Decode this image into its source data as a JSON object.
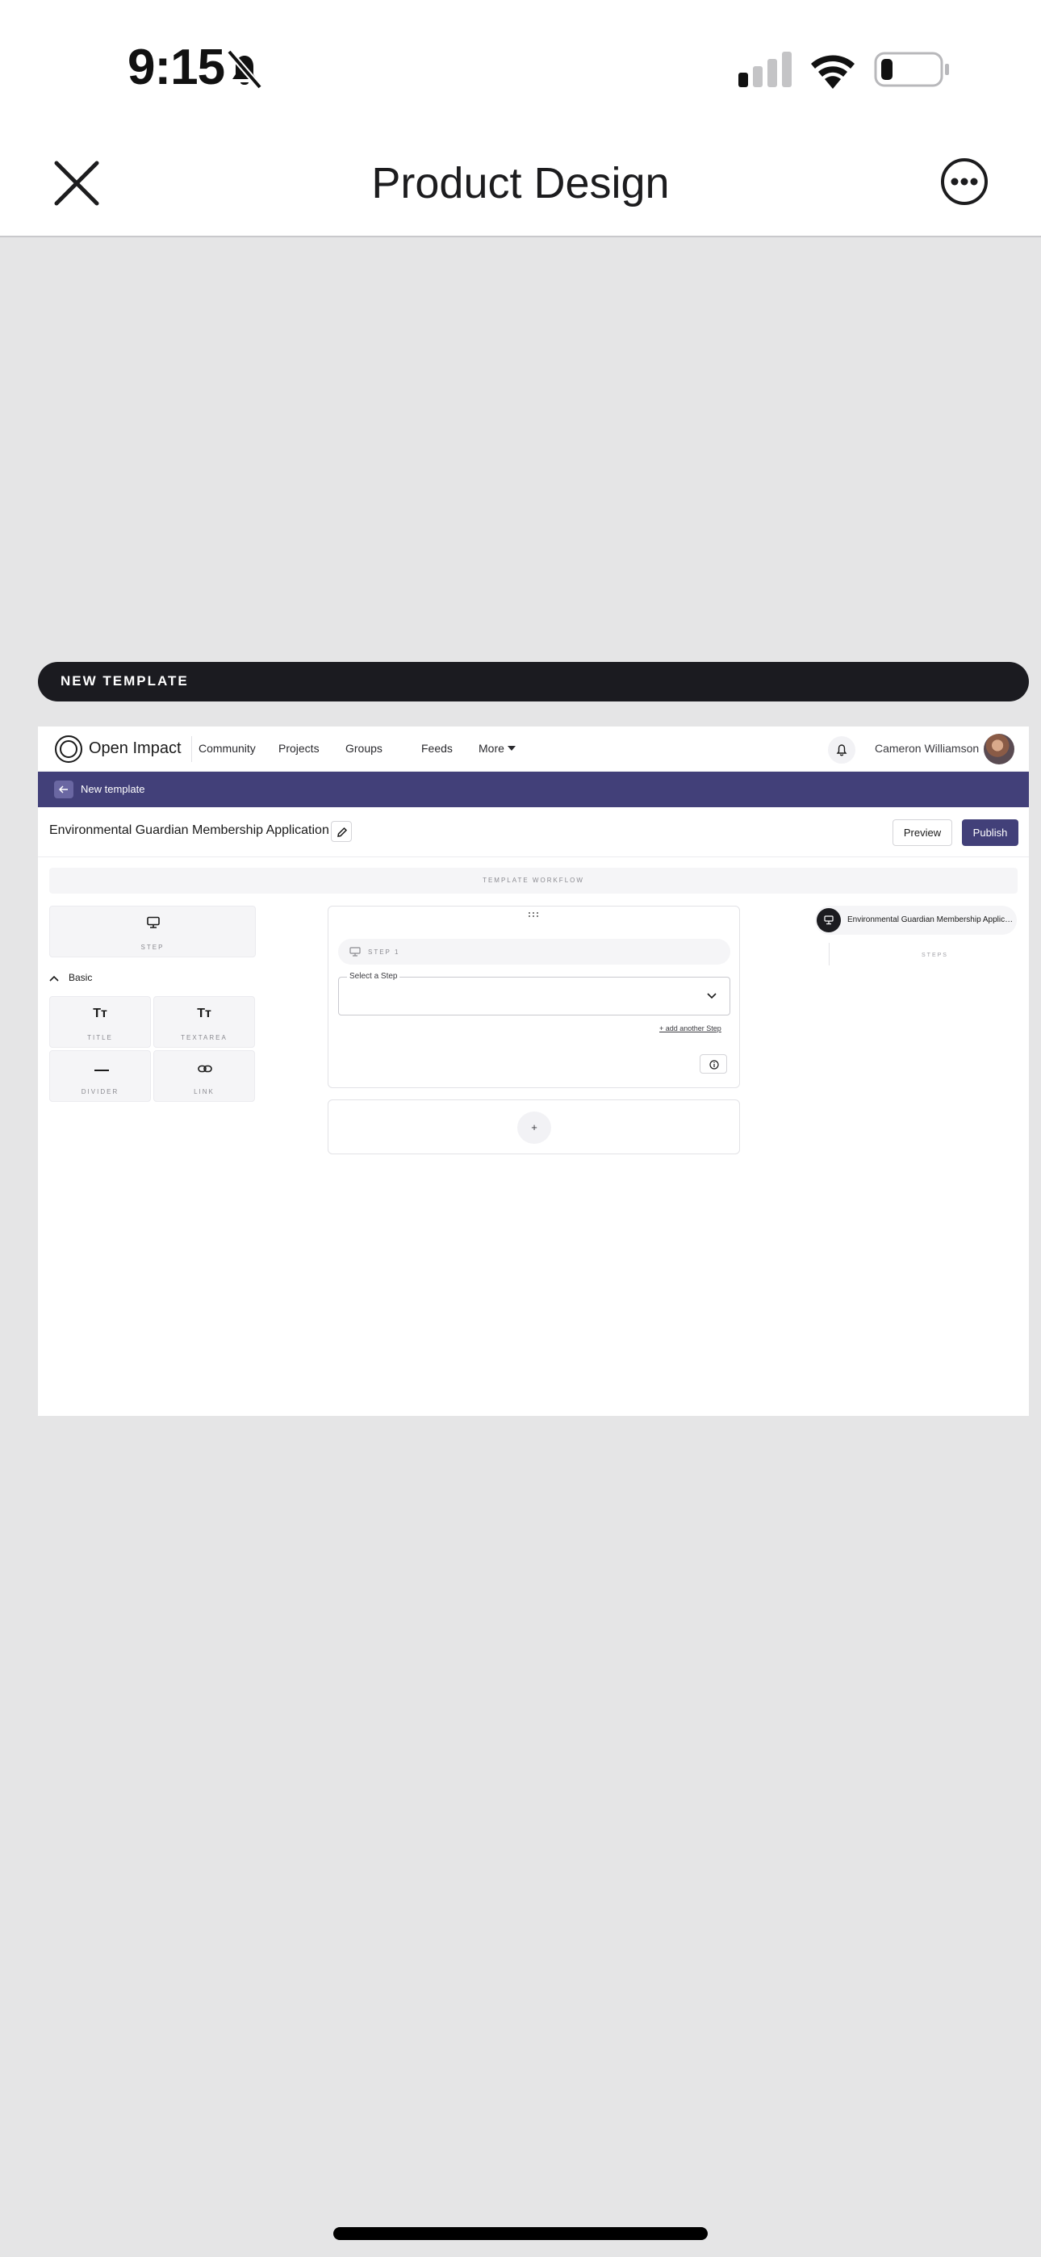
{
  "status_bar": {
    "time": "9:15"
  },
  "header": {
    "title": "Product Design"
  },
  "pill": {
    "label": "NEW TEMPLATE"
  },
  "app": {
    "brand": "Open Impact",
    "nav": [
      "Community",
      "Projects",
      "Groups",
      "Feeds",
      "More"
    ],
    "user_name": "Cameron Williamson",
    "accent_color": "#424079",
    "subheader_title": "New template",
    "doc_title": "Environmental Guardian Membership Application",
    "preview_label": "Preview",
    "publish_label": "Publish",
    "workflow_label": "TEMPLATE WORKFLOW",
    "palette": {
      "step_label": "STEP",
      "section_label": "Basic",
      "elements": [
        {
          "label": "TITLE",
          "icon": "text-size-icon"
        },
        {
          "label": "TEXTAREA",
          "icon": "text-size-icon"
        },
        {
          "label": "DIVIDER",
          "icon": "divider-icon"
        },
        {
          "label": "LINK",
          "icon": "link-icon"
        }
      ]
    },
    "step_card": {
      "header_label": "STEP 1",
      "select_label": "Select a Step",
      "add_link": "+ add another Step"
    },
    "add_card_label": "+",
    "sidebar": {
      "chip_text": "Environmental Guardian Membership Application",
      "steps_label": "STEPS"
    }
  }
}
